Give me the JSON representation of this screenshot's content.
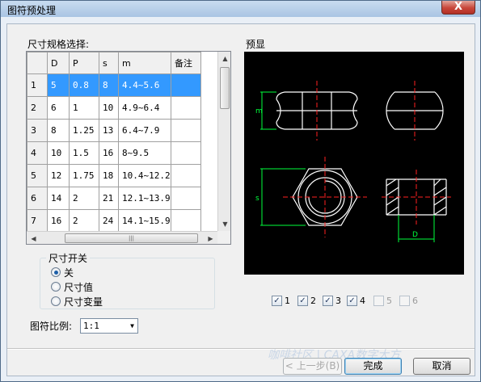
{
  "window": {
    "title": "图符预处理",
    "close_glyph": "X"
  },
  "size_selection": {
    "label": "尺寸规格选择:",
    "columns": [
      "D",
      "P",
      "s",
      "m",
      "备注"
    ],
    "rows": [
      {
        "num": "1",
        "D": "5",
        "P": "0.8",
        "s": "8",
        "m": "4.4~5.6",
        "note": ""
      },
      {
        "num": "2",
        "D": "6",
        "P": "1",
        "s": "10",
        "m": "4.9~6.4",
        "note": ""
      },
      {
        "num": "3",
        "D": "8",
        "P": "1.25",
        "s": "13",
        "m": "6.4~7.9",
        "note": ""
      },
      {
        "num": "4",
        "D": "10",
        "P": "1.5",
        "s": "16",
        "m": "8~9.5",
        "note": ""
      },
      {
        "num": "5",
        "D": "12",
        "P": "1.75",
        "s": "18",
        "m": "10.4~12.2",
        "note": ""
      },
      {
        "num": "6",
        "D": "14",
        "P": "2",
        "s": "21",
        "m": "12.1~13.9",
        "note": ""
      },
      {
        "num": "7",
        "D": "16",
        "P": "2",
        "s": "24",
        "m": "14.1~15.9",
        "note": ""
      }
    ],
    "selected_row": 1
  },
  "preview": {
    "label": "预显",
    "colors": {
      "background": "#000000",
      "outline": "#ffffff",
      "center": "#ff2020",
      "dimension": "#00ff3c"
    },
    "dim_labels": {
      "height": "m",
      "width": "s",
      "diameter": "D"
    }
  },
  "size_switch": {
    "title": "尺寸开关",
    "options": [
      {
        "label": "关",
        "selected": true
      },
      {
        "label": "尺寸值",
        "selected": false
      },
      {
        "label": "尺寸变量",
        "selected": false
      }
    ]
  },
  "views": [
    {
      "label": "1",
      "checked": true,
      "enabled": true
    },
    {
      "label": "2",
      "checked": true,
      "enabled": true
    },
    {
      "label": "3",
      "checked": true,
      "enabled": true
    },
    {
      "label": "4",
      "checked": true,
      "enabled": true
    },
    {
      "label": "5",
      "checked": false,
      "enabled": false
    },
    {
      "label": "6",
      "checked": false,
      "enabled": false
    }
  ],
  "scale": {
    "label": "图符比例:",
    "value": "1:1"
  },
  "buttons": {
    "back": "< 上一步(B)",
    "finish": "完成",
    "cancel": "取消"
  },
  "watermark": "咖啡社区 | CAXA数字大方"
}
